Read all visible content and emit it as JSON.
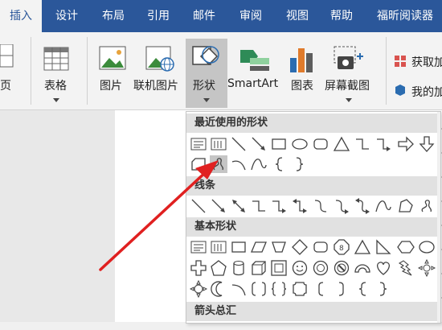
{
  "tabs": [
    {
      "label": "插入",
      "active": true
    },
    {
      "label": "设计"
    },
    {
      "label": "布局"
    },
    {
      "label": "引用"
    },
    {
      "label": "邮件"
    },
    {
      "label": "审阅"
    },
    {
      "label": "视图"
    },
    {
      "label": "帮助"
    },
    {
      "label": "福昕阅读器"
    }
  ],
  "ribbon": {
    "page_partial": "页",
    "table_btn": "表格",
    "table_group": "表格",
    "picture": "图片",
    "online_picture": "联机图片",
    "shapes": "形状",
    "smartart": "SmartArt",
    "chart": "图表",
    "screenshot": "屏幕截图",
    "get_addins": "获取加",
    "my_addins": "我的加"
  },
  "gallery": {
    "recent_header": "最近使用的形状",
    "lines_header": "线条",
    "basic_header": "基本形状",
    "arrows_header": "箭头总汇"
  },
  "colors": {
    "accent": "#2b579a",
    "arrow": "#e02020"
  }
}
